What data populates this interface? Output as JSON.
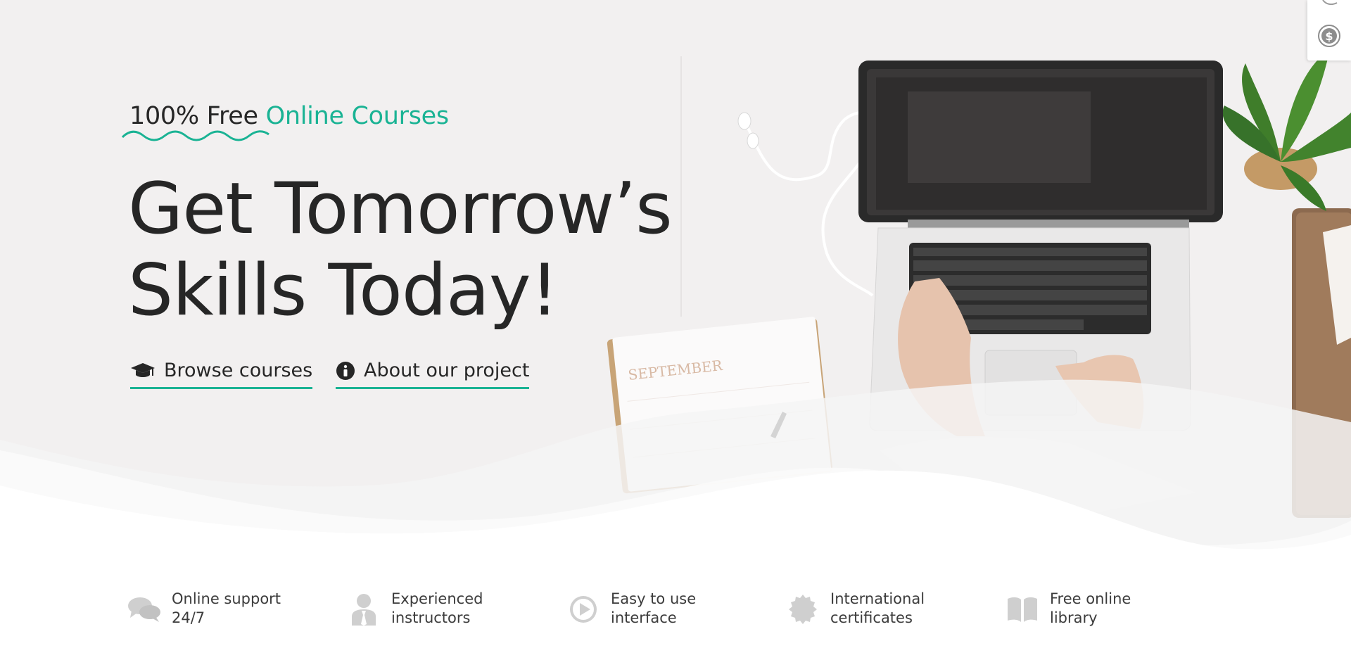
{
  "hero": {
    "eyebrow_plain": "100% Free ",
    "eyebrow_accent": "Online Courses",
    "headline_line1": "Get Tomorrow’s",
    "headline_line2": "Skills Today!",
    "accent_color": "#1ab394"
  },
  "buttons": {
    "browse_label": "Browse courses",
    "browse_icon": "graduation-cap-icon",
    "about_label": "About our project",
    "about_icon": "info-circle-icon"
  },
  "features": [
    {
      "line1": "Online support",
      "line2": "24/7",
      "icon": "chat-bubbles-icon"
    },
    {
      "line1": "Experienced",
      "line2": "instructors",
      "icon": "instructor-icon"
    },
    {
      "line1": "Easy to use",
      "line2": "interface",
      "icon": "play-circle-icon"
    },
    {
      "line1": "International",
      "line2": "certificates",
      "icon": "certificate-badge-icon"
    },
    {
      "line1": "Free online",
      "line2": "library",
      "icon": "open-book-icon"
    }
  ],
  "side_panel": {
    "icons": [
      "edit-icon",
      "dollar-coin-icon"
    ]
  }
}
